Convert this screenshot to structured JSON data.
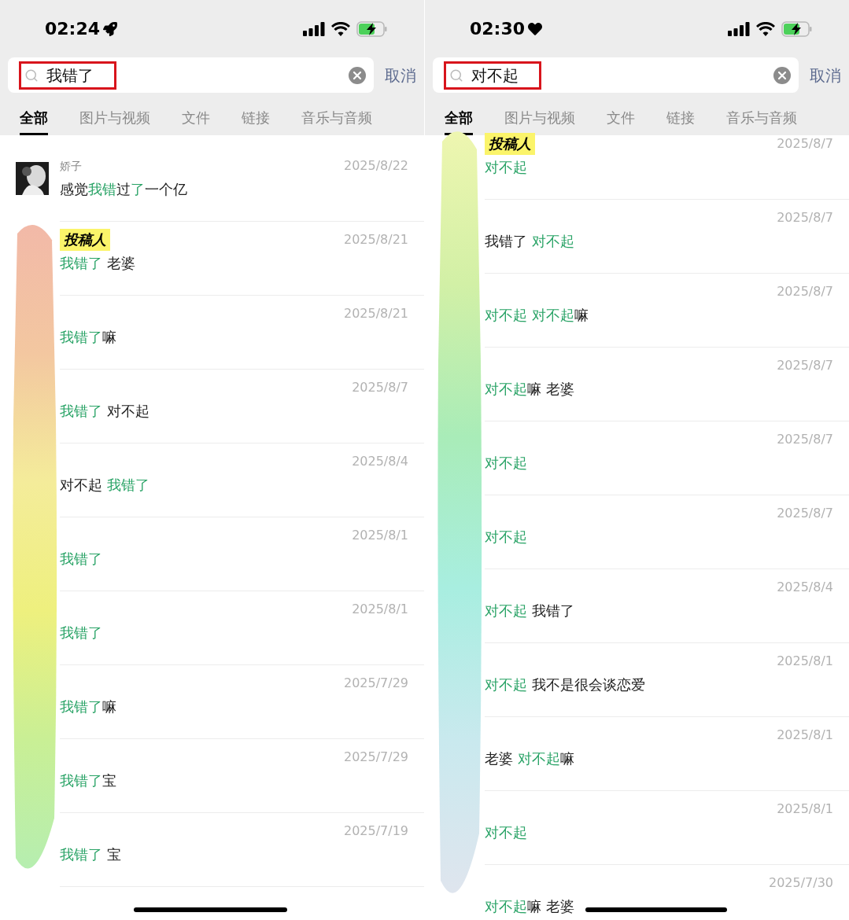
{
  "panels": [
    {
      "status_bar": {
        "time": "02:24",
        "icon": {
          "kind": "rocket"
        }
      },
      "search": {
        "value": "我错了"
      },
      "cancel": "取消",
      "tabs": [
        {
          "label": "全部",
          "selected": true
        },
        {
          "label": "图片与视频",
          "selected": false
        },
        {
          "label": "文件",
          "selected": false
        },
        {
          "label": "链接",
          "selected": false
        },
        {
          "label": "音乐与音频",
          "selected": false
        }
      ],
      "results": [
        {
          "sender": "娇子",
          "date": "2025/8/22",
          "segments": [
            {
              "text": "感觉",
              "hit": false
            },
            {
              "text": "我错",
              "hit": true
            },
            {
              "text": "过",
              "hit": false
            },
            {
              "text": "了",
              "hit": true
            },
            {
              "text": "一个亿",
              "hit": false
            }
          ]
        },
        {
          "tag": "投稿人",
          "date": "2025/8/21",
          "segments": [
            {
              "text": "我错了",
              "hit": true
            },
            {
              "text": " 老婆",
              "hit": false
            }
          ]
        },
        {
          "date": "2025/8/21",
          "segments": [
            {
              "text": "我错了",
              "hit": true
            },
            {
              "text": "嘛",
              "hit": false
            }
          ]
        },
        {
          "date": "2025/8/7",
          "segments": [
            {
              "text": "我错了",
              "hit": true
            },
            {
              "text": " 对不起",
              "hit": false
            }
          ]
        },
        {
          "date": "2025/8/4",
          "segments": [
            {
              "text": "对不起 ",
              "hit": false
            },
            {
              "text": "我错了",
              "hit": true
            }
          ]
        },
        {
          "date": "2025/8/1",
          "segments": [
            {
              "text": "我错了",
              "hit": true
            }
          ]
        },
        {
          "date": "2025/8/1",
          "segments": [
            {
              "text": "我错了",
              "hit": true
            }
          ]
        },
        {
          "date": "2025/7/29",
          "segments": [
            {
              "text": "我错了",
              "hit": true
            },
            {
              "text": "嘛",
              "hit": false
            }
          ]
        },
        {
          "date": "2025/7/29",
          "segments": [
            {
              "text": "我错了",
              "hit": true
            },
            {
              "text": "宝",
              "hit": false
            }
          ]
        },
        {
          "date": "2025/7/19",
          "segments": [
            {
              "text": "我错了",
              "hit": true
            },
            {
              "text": " 宝",
              "hit": false
            }
          ]
        }
      ]
    },
    {
      "status_bar": {
        "time": "02:30",
        "icon": {
          "kind": "heart"
        }
      },
      "search": {
        "value": "对不起"
      },
      "cancel": "取消",
      "tabs": [
        {
          "label": "全部",
          "selected": true
        },
        {
          "label": "图片与视频",
          "selected": false
        },
        {
          "label": "文件",
          "selected": false
        },
        {
          "label": "链接",
          "selected": false
        },
        {
          "label": "音乐与音频",
          "selected": false
        }
      ],
      "results": [
        {
          "tag": "投稿人",
          "date": "2025/8/7",
          "segments": [
            {
              "text": "对不起",
              "hit": true
            }
          ]
        },
        {
          "date": "2025/8/7",
          "segments": [
            {
              "text": "我错了 ",
              "hit": false
            },
            {
              "text": "对不起",
              "hit": true
            }
          ]
        },
        {
          "date": "2025/8/7",
          "segments": [
            {
              "text": "对不起 对不起",
              "hit": true
            },
            {
              "text": "嘛",
              "hit": false
            }
          ]
        },
        {
          "date": "2025/8/7",
          "segments": [
            {
              "text": "对不起",
              "hit": true
            },
            {
              "text": "嘛 老婆",
              "hit": false
            }
          ]
        },
        {
          "date": "2025/8/7",
          "segments": [
            {
              "text": "对不起",
              "hit": true
            }
          ]
        },
        {
          "date": "2025/8/7",
          "segments": [
            {
              "text": "对不起",
              "hit": true
            }
          ]
        },
        {
          "date": "2025/8/4",
          "segments": [
            {
              "text": "对不起",
              "hit": true
            },
            {
              "text": " 我错了",
              "hit": false
            }
          ]
        },
        {
          "date": "2025/8/1",
          "segments": [
            {
              "text": "对不起",
              "hit": true
            },
            {
              "text": " 我不是很会谈恋爱",
              "hit": false
            }
          ]
        },
        {
          "date": "2025/8/1",
          "segments": [
            {
              "text": "老婆 ",
              "hit": false
            },
            {
              "text": "对不起",
              "hit": true
            },
            {
              "text": "嘛",
              "hit": false
            }
          ]
        },
        {
          "date": "2025/8/1",
          "segments": [
            {
              "text": "对不起",
              "hit": true
            }
          ]
        },
        {
          "date": "2025/7/30",
          "segments": [
            {
              "text": "对不起",
              "hit": true
            },
            {
              "text": "嘛 老婆",
              "hit": false
            }
          ]
        }
      ]
    }
  ]
}
